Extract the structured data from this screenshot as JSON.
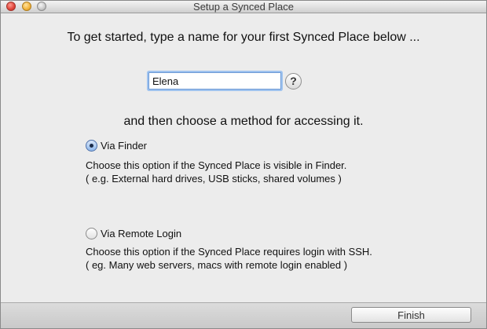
{
  "window": {
    "title": "Setup a Synced Place"
  },
  "intro": "To get started, type a name for your first Synced Place below ...",
  "name_field": {
    "value": "Elena"
  },
  "help_label": "?",
  "then_text": "and then choose a method for accessing it.",
  "options": [
    {
      "label": "Via Finder",
      "selected": true,
      "desc1": "Choose this option if the Synced Place is visible in Finder.",
      "desc2": "( e.g. External hard drives, USB sticks, shared volumes )"
    },
    {
      "label": "Via Remote Login",
      "selected": false,
      "desc1": "Choose this option if the Synced Place requires login with SSH.",
      "desc2": "( eg. Many web servers, macs with remote login enabled )"
    }
  ],
  "finish_label": "Finish"
}
